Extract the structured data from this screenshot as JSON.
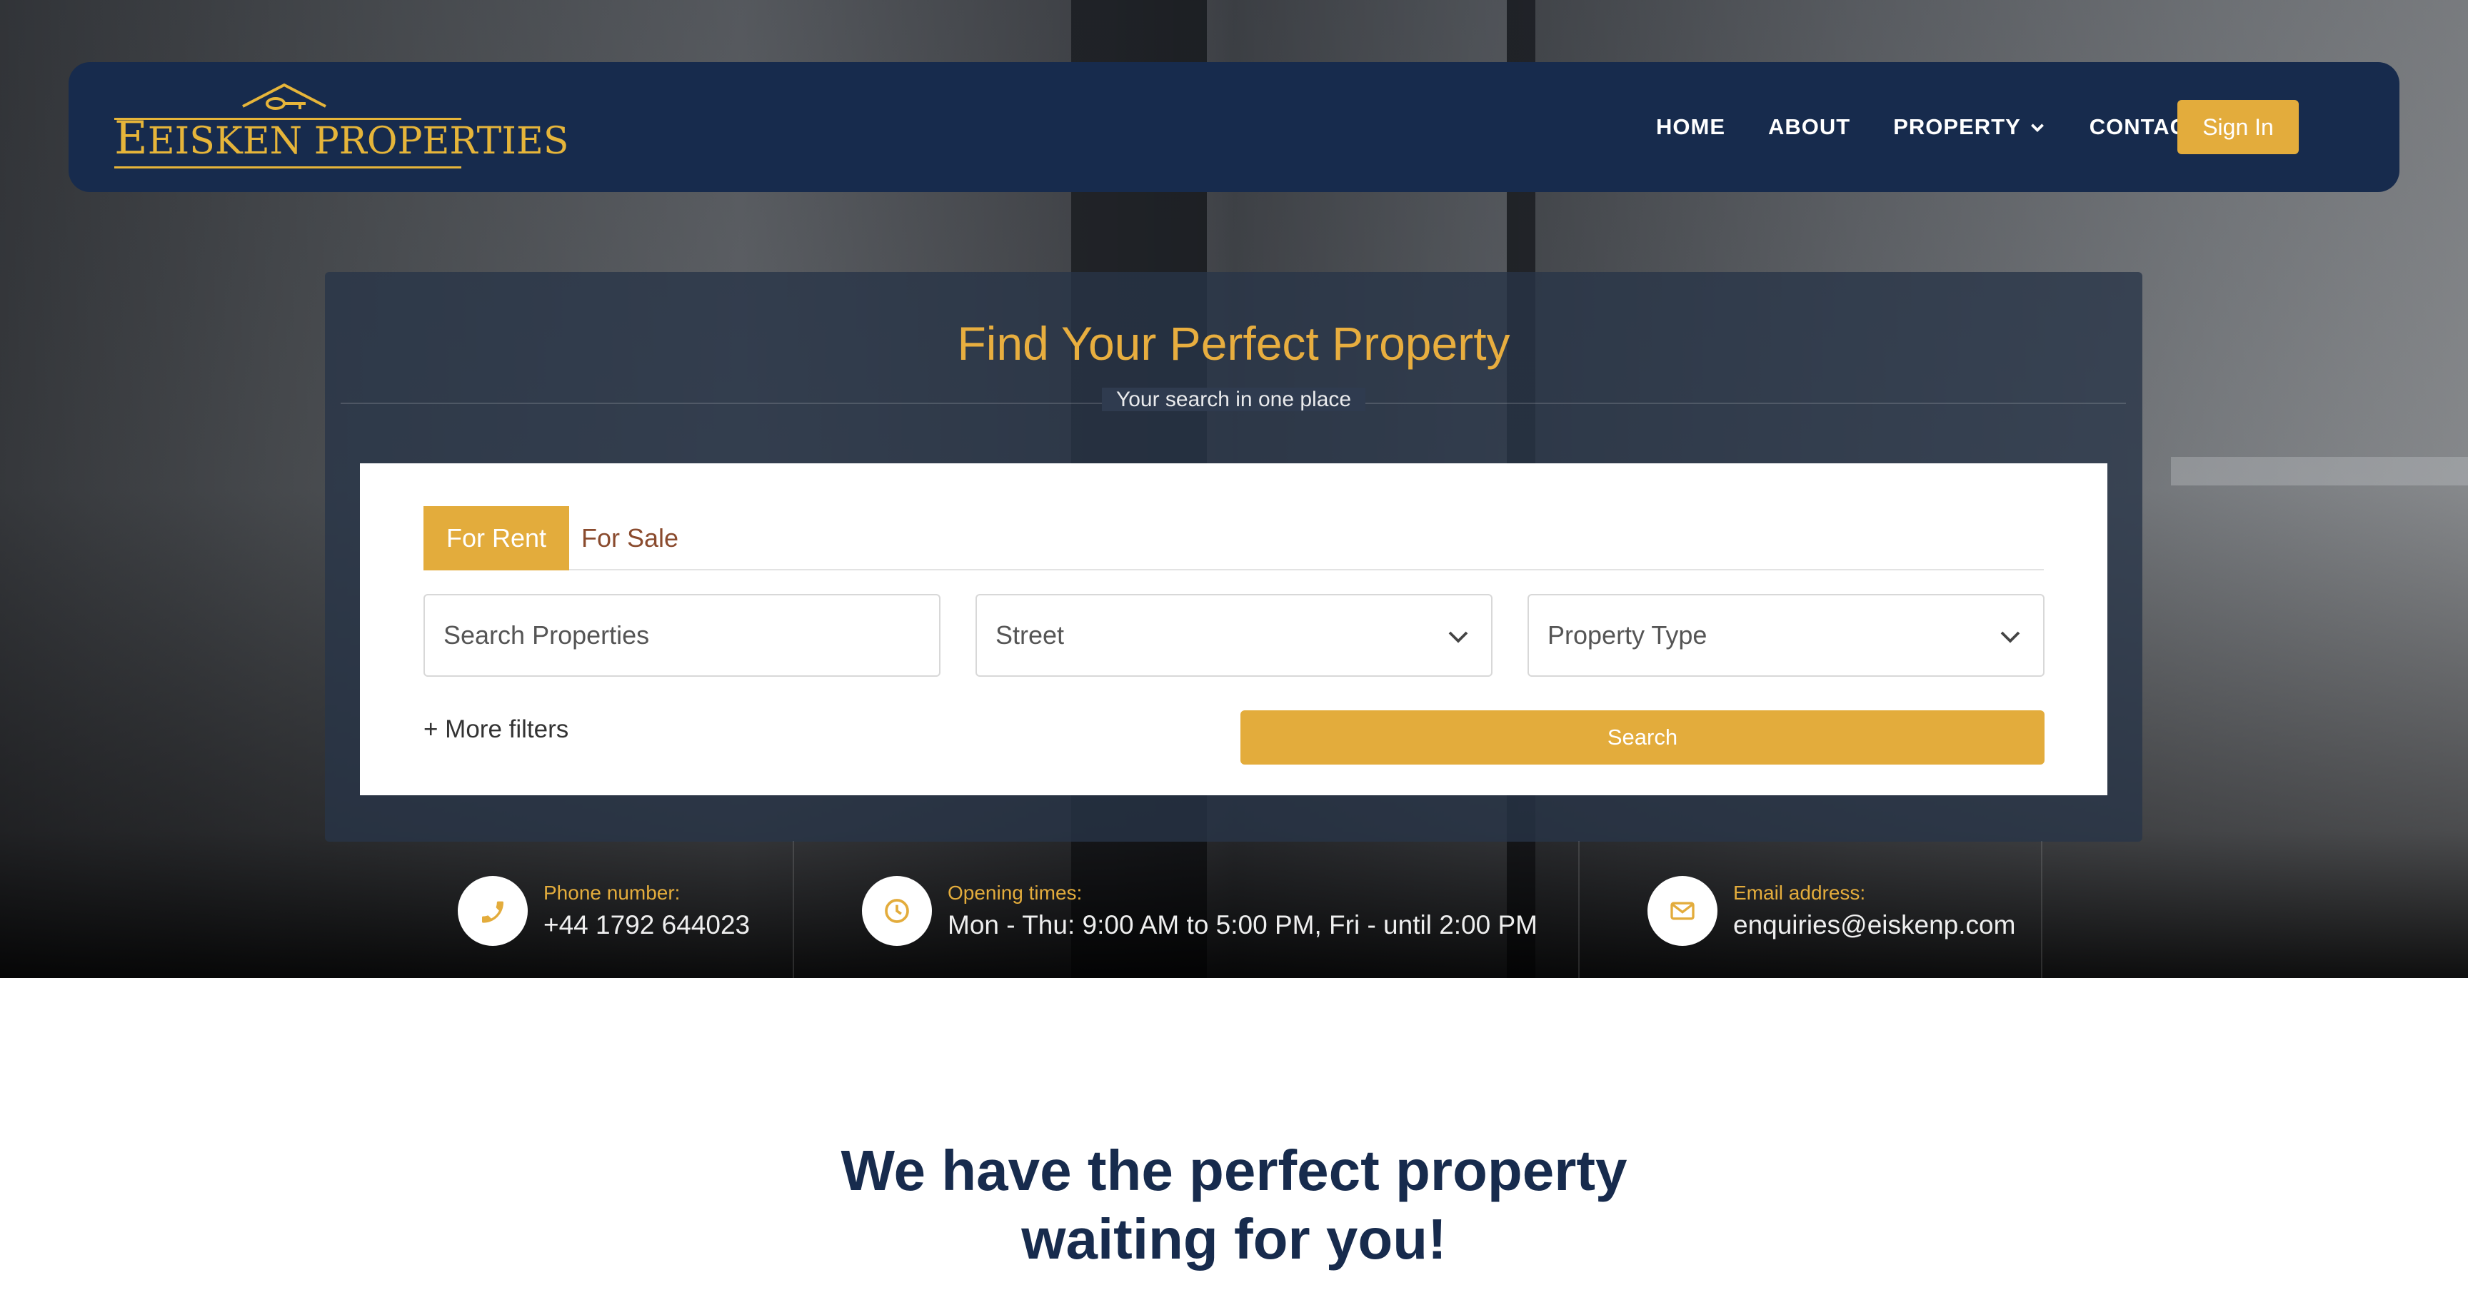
{
  "brand": {
    "name_part1": "Eisken",
    "name_part2": "Properties"
  },
  "nav": {
    "items": [
      {
        "label": "HOME"
      },
      {
        "label": "ABOUT"
      },
      {
        "label": "PROPERTY"
      },
      {
        "label": "CONTACT"
      }
    ],
    "signin_label": "Sign In"
  },
  "search": {
    "title": "Find Your Perfect Property",
    "subtitle": "Your search in one place",
    "tabs": [
      {
        "label": "For Rent",
        "active": true
      },
      {
        "label": "For Sale",
        "active": false
      }
    ],
    "fields": {
      "search_placeholder": "Search Properties",
      "street_selected": "Street",
      "property_type_selected": "Property Type"
    },
    "more_filters_label": "+ More filters",
    "search_button_label": "Search"
  },
  "contact": {
    "phone": {
      "label": "Phone number:",
      "value": "+44 1792 644023",
      "icon": "phone-icon"
    },
    "hours": {
      "label": "Opening times:",
      "value": "Mon - Thu: 9:00 AM to 5:00 PM, Fri - until 2:00 PM",
      "icon": "clock-icon"
    },
    "email": {
      "label": "Email address:",
      "value": "enquiries@eiskenp.com",
      "icon": "envelope-icon"
    }
  },
  "headline": {
    "line1": "We have the perfect property",
    "line2": "waiting for you!"
  },
  "colors": {
    "navy": "#172b4d",
    "gold": "#e3ac3c",
    "panel": "#283448"
  }
}
